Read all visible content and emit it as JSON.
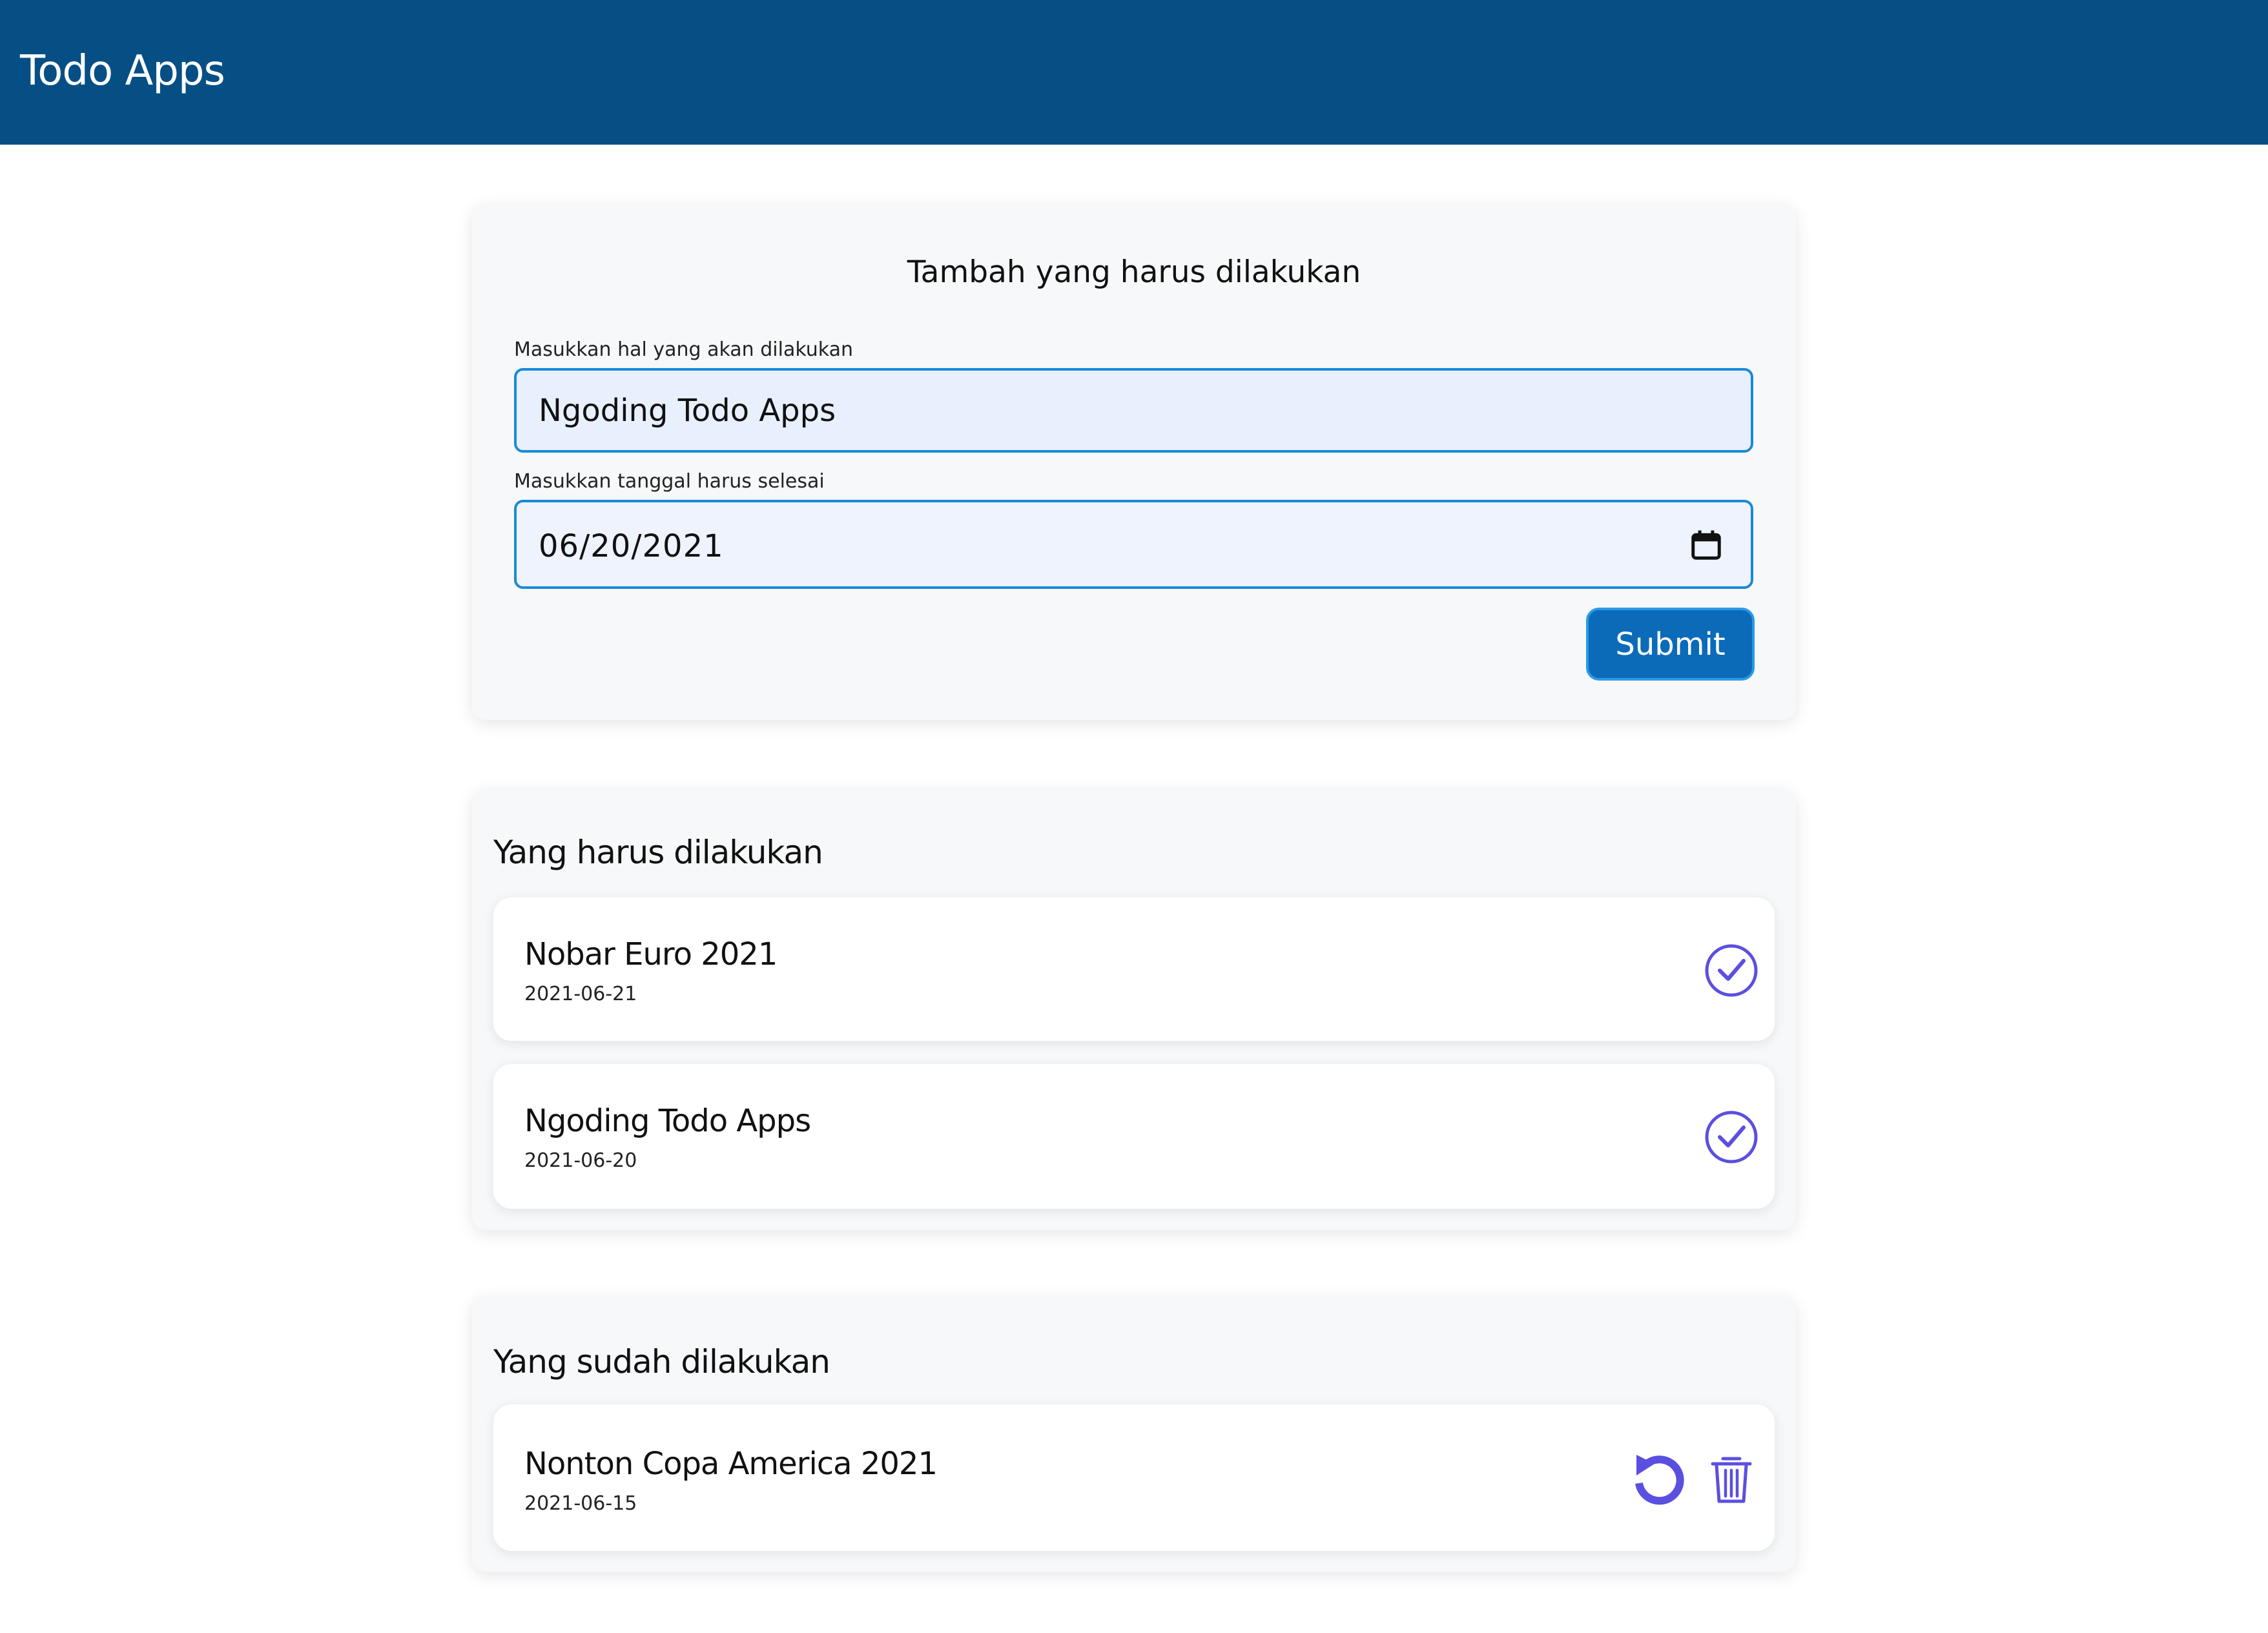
{
  "header": {
    "title": "Todo Apps",
    "background_color": "#064f85"
  },
  "form": {
    "heading": "Tambah yang harus dilakukan",
    "title_label": "Masukkan hal yang akan dilakukan",
    "title_value": "Ngoding Todo Apps",
    "date_label": "Masukkan tanggal harus selesai",
    "date_value": "06/20/2021",
    "date_icon": "calendar-icon",
    "submit_label": "Submit",
    "submit_color": "#0b6bb8"
  },
  "todo_section": {
    "heading": "Yang harus dilakukan",
    "items": [
      {
        "title": "Nobar Euro 2021",
        "date": "2021-06-21",
        "action_icon": "check-circle-icon"
      },
      {
        "title": "Ngoding Todo Apps",
        "date": "2021-06-20",
        "action_icon": "check-circle-icon"
      }
    ]
  },
  "done_section": {
    "heading": "Yang sudah dilakukan",
    "items": [
      {
        "title": "Nonton Copa America 2021",
        "date": "2021-06-15",
        "action_icons": [
          "undo-icon",
          "trash-icon"
        ]
      }
    ]
  },
  "accent_color": "#5b4fe0"
}
